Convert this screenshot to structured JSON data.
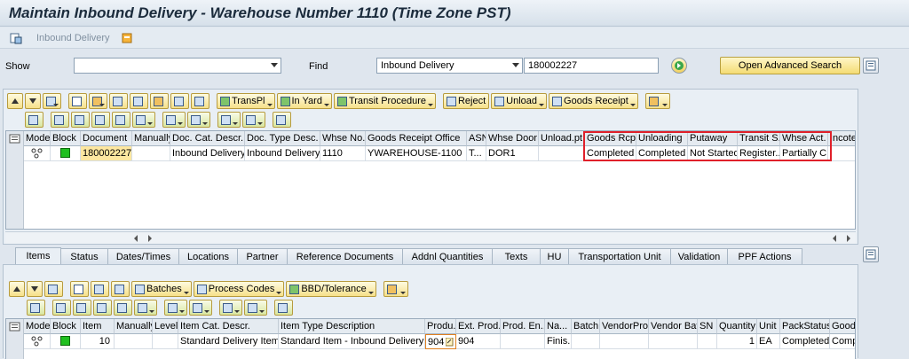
{
  "window": {
    "title": "Maintain Inbound Delivery - Warehouse Number 1110 (Time Zone PST)"
  },
  "app_toolbar": {
    "label": "Inbound Delivery"
  },
  "search": {
    "show_label": "Show",
    "show_value": "",
    "find_label": "Find",
    "find_value": "Inbound Delivery",
    "search_value": "180002227",
    "advanced_label": "Open Advanced Search"
  },
  "toolbar1": {
    "transpl": "TransPl",
    "inyard": "In Yard",
    "transit": "Transit Procedure",
    "reject": "Reject",
    "unload": "Unload",
    "goods_receipt": "Goods Receipt"
  },
  "header_grid": {
    "columns": [
      "Mode",
      "Block",
      "Document",
      "Manually",
      "Doc. Cat. Descr.",
      "Doc. Type Desc.",
      "Whse No.",
      "Goods Receipt Office",
      "ASN",
      "Whse Door",
      "Unload.pt.",
      "Goods Rcpt",
      "Unloading",
      "Putaway",
      "Transit S.",
      "Whse Act.",
      "Incoter"
    ],
    "row": {
      "document": "180002227",
      "doc_cat": "Inbound Delivery",
      "doc_type": "Inbound Delivery",
      "whse_no": "1110",
      "gr_office": "YWAREHOUSE-1100",
      "asn": "T...",
      "whse_door": "DOR1",
      "unload_pt": "",
      "goods_rcpt": "Completed",
      "unloading": "Completed",
      "putaway": "Not Started",
      "transit": "Register...",
      "whse_act": "Partially C..."
    }
  },
  "tabs": [
    "Items",
    "Status",
    "Dates/Times",
    "Locations",
    "Partner",
    "Reference Documents",
    "Addnl Quantities",
    "Texts",
    "HU",
    "Transportation Unit",
    "Validation",
    "PPF Actions"
  ],
  "toolbar2": {
    "batches": "Batches",
    "process_codes": "Process Codes",
    "bbd": "BBD/Tolerance"
  },
  "item_grid": {
    "columns": [
      "Mode",
      "Block",
      "Item",
      "Manually",
      "Level",
      "Item Cat. Descr.",
      "Item Type Description",
      "Produ...",
      "Ext. Prod.",
      "Prod. En...",
      "Na...",
      "Batch",
      "VendorProd",
      "Vendor Bat",
      "SN",
      "Quantity",
      "Unit",
      "PackStatus",
      "Goods"
    ],
    "row": {
      "item": "10",
      "item_cat": "Standard Delivery Item",
      "item_type": "Standard Item - Inbound Delivery",
      "product": "904",
      "ext_prod": "904",
      "na": "Finis...",
      "quantity": "1",
      "unit": "EA",
      "pack_status": "Completed",
      "goods": "Comp..."
    }
  }
}
